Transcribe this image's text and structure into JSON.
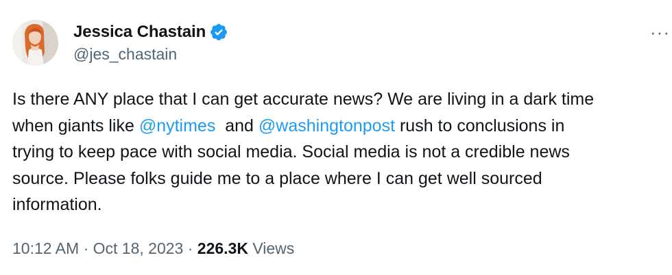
{
  "author": {
    "display_name": "Jessica Chastain",
    "handle": "@jes_chastain",
    "verified": true,
    "verified_color": "#1d9bf0"
  },
  "menu_icon": "more-horizontal-icon",
  "tweet": {
    "line1": "Is there ANY place that I can get accurate news? We are living in a dark time",
    "line2_prefix": "when giants like ",
    "mention1": "@nytimes",
    "line2_middle": "  and ",
    "mention2": "@washingtonpost",
    "line2_suffix": " rush to conclusions in",
    "line3": "trying to keep pace with social media. Social media is not a credible news",
    "line4": "source. Please folks guide me to a place where I can get well sourced",
    "line5": "information."
  },
  "meta": {
    "time": "10:12 AM",
    "separator": " · ",
    "date": "Oct 18, 2023",
    "views_count": "226.3K",
    "views_label": " Views"
  },
  "colors": {
    "text": "#0f1419",
    "secondary": "#536471",
    "link": "#1d9bf0"
  }
}
